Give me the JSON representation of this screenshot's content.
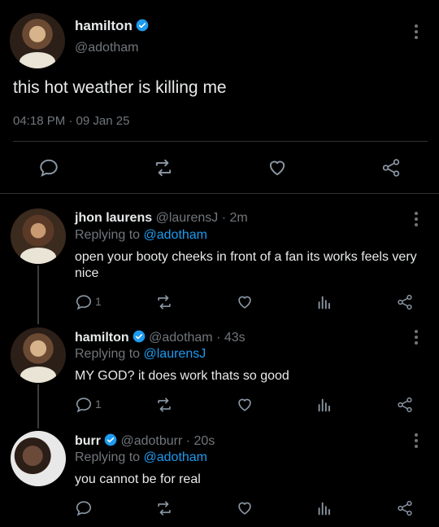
{
  "main_tweet": {
    "name": "hamilton",
    "handle": "@adotham",
    "text": "this hot weather is killing me",
    "timestamp": "04:18 PM · 09 Jan 25"
  },
  "replies": [
    {
      "name": "jhon laurens",
      "meta": "@laurensJ · 2m",
      "replying_prefix": "Replying to",
      "replying_to": "@adotham",
      "text": "open your booty cheeks in front of a fan its works feels very nice",
      "reply_count": "1"
    },
    {
      "name": "hamilton",
      "meta": "@adotham · 43s",
      "replying_prefix": "Replying to",
      "replying_to": "@laurensJ",
      "text": "MY GOD? it does work thats so good",
      "reply_count": "1"
    },
    {
      "name": "burr",
      "meta": "@adotburr · 20s",
      "replying_prefix": "Replying to",
      "replying_to": "@adotham",
      "text": "you cannot be for real",
      "reply_count": ""
    }
  ],
  "colors": {
    "background": "#000000",
    "accent": "#1d9bf0",
    "muted": "#71767b"
  },
  "icons": [
    "verified-badge-icon",
    "more-icon",
    "reply-icon",
    "retweet-icon",
    "like-icon",
    "share-icon",
    "analytics-icon"
  ]
}
